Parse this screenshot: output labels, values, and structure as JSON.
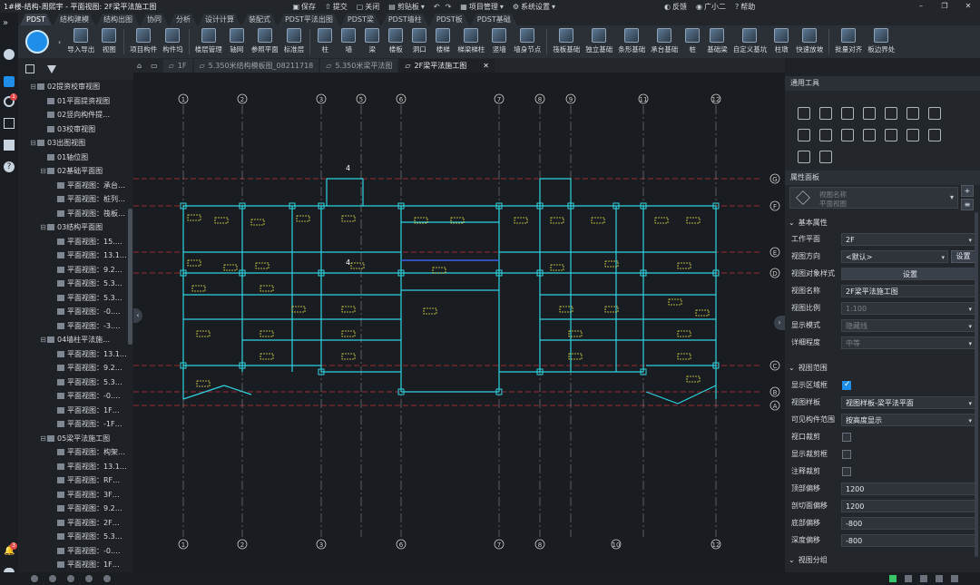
{
  "titlebar": {
    "title": "1#楼-结构-周熙宇 - 平面视图: 2F梁平法施工图",
    "quick": [
      "保存",
      "提交",
      "关闭",
      "剪贴板",
      "项目管理",
      "系统设置"
    ],
    "right": [
      "反馈",
      "广小二",
      "帮助"
    ]
  },
  "ribbon_tabs": [
    "PDST",
    "结构建模",
    "结构出图",
    "协同",
    "分析",
    "设计计算",
    "装配式",
    "PDST平法出图",
    "PDST梁",
    "PDST墙柱",
    "PDST板",
    "PDST基础"
  ],
  "ribbon_groups": [
    [
      "导入导出",
      "视图"
    ],
    [
      "项目构件",
      "构件坞"
    ],
    [
      "楼层管理",
      "轴网",
      "参照平面",
      "标准层"
    ],
    [
      "柱",
      "墙",
      "梁",
      "楼板",
      "洞口",
      "楼梯",
      "梯梁梯柱",
      "竖墙",
      "墙身节点"
    ],
    [
      "筏板基础",
      "独立基础",
      "条形基础",
      "承台基础",
      "桩",
      "基础梁",
      "自定义基坑",
      "柱墩",
      "快速放坡"
    ],
    [
      "批量对齐",
      "板边界处"
    ]
  ],
  "tree": [
    {
      "level": 1,
      "toggle": "⊟",
      "label": "02提资校审视图"
    },
    {
      "level": 2,
      "toggle": "",
      "label": "01平面提资视图"
    },
    {
      "level": 2,
      "toggle": "",
      "label": "02竖向构件提…"
    },
    {
      "level": 2,
      "toggle": "",
      "label": "03校审视图"
    },
    {
      "level": 1,
      "toggle": "⊟",
      "label": "03出图视图"
    },
    {
      "level": 2,
      "toggle": "",
      "label": "01轴位图"
    },
    {
      "level": 2,
      "toggle": "⊟",
      "label": "02基础平面图"
    },
    {
      "level": 3,
      "toggle": "",
      "label": "平面视图：承台…"
    },
    {
      "level": 3,
      "toggle": "",
      "label": "平面视图：桩列…"
    },
    {
      "level": 3,
      "toggle": "",
      "label": "平面视图：筏板…"
    },
    {
      "level": 2,
      "toggle": "⊟",
      "label": "03结构平面图"
    },
    {
      "level": 3,
      "toggle": "",
      "label": "平面视图：15.…"
    },
    {
      "level": 3,
      "toggle": "",
      "label": "平面视图：13.1…"
    },
    {
      "level": 3,
      "toggle": "",
      "label": "平面视图：9.2…"
    },
    {
      "level": 3,
      "toggle": "",
      "label": "平面视图：5.3…"
    },
    {
      "level": 3,
      "toggle": "",
      "label": "平面视图：5.3…"
    },
    {
      "level": 3,
      "toggle": "",
      "label": "平面视图：-0.…"
    },
    {
      "level": 3,
      "toggle": "",
      "label": "平面视图：-3.…"
    },
    {
      "level": 2,
      "toggle": "⊟",
      "label": "04墙柱平法施…"
    },
    {
      "level": 3,
      "toggle": "",
      "label": "平面视图：13.1…"
    },
    {
      "level": 3,
      "toggle": "",
      "label": "平面视图：9.2…"
    },
    {
      "level": 3,
      "toggle": "",
      "label": "平面视图：5.3…"
    },
    {
      "level": 3,
      "toggle": "",
      "label": "平面视图：-0.…"
    },
    {
      "level": 3,
      "toggle": "",
      "label": "平面视图：1F…"
    },
    {
      "level": 3,
      "toggle": "",
      "label": "平面视图：-1F…"
    },
    {
      "level": 2,
      "toggle": "⊟",
      "label": "05梁平法施工图"
    },
    {
      "level": 3,
      "toggle": "",
      "label": "平面视图：构架…"
    },
    {
      "level": 3,
      "toggle": "",
      "label": "平面视图：13.1…"
    },
    {
      "level": 3,
      "toggle": "",
      "label": "平面视图：RF…"
    },
    {
      "level": 3,
      "toggle": "",
      "label": "平面视图：3F…"
    },
    {
      "level": 3,
      "toggle": "",
      "label": "平面视图：9.2…"
    },
    {
      "level": 3,
      "toggle": "",
      "label": "平面视图：2F…"
    },
    {
      "level": 3,
      "toggle": "",
      "label": "平面视图：5.3…"
    },
    {
      "level": 3,
      "toggle": "",
      "label": "平面视图：-0.…"
    },
    {
      "level": 3,
      "toggle": "",
      "label": "平面视图：1F…"
    }
  ],
  "doc_tabs": [
    "1F",
    "5.350米结构模板图_08211718",
    "5.350米梁平法图",
    "2F梁平法施工图"
  ],
  "axes": {
    "vertical": [
      "1",
      "2",
      "3",
      "5",
      "6",
      "7",
      "8",
      "9",
      "11",
      "12"
    ],
    "horizontal": [
      "G",
      "F",
      "E",
      "D",
      "C",
      "B",
      "A"
    ],
    "bottom": [
      "1",
      "2",
      "3",
      "6",
      "7",
      "8",
      "10",
      "12"
    ],
    "marker": "4"
  },
  "props": {
    "tools_title": "通用工具",
    "panel_title": "属性面板",
    "view_type_label": "视图名称",
    "view_type_value": "平面视图",
    "section_basic": "基本属性",
    "section_range": "视图范围",
    "section_group": "视图分组",
    "button_set": "设置",
    "rows": [
      {
        "k": "工作平面",
        "v": "2F",
        "type": "select"
      },
      {
        "k": "视图方向",
        "v": "<默认>",
        "type": "select",
        "btn": "设置"
      },
      {
        "k": "视图对象样式",
        "v": "设置",
        "type": "button"
      },
      {
        "k": "视图名称",
        "v": "2F梁平法施工图",
        "type": "text"
      },
      {
        "k": "视图比例",
        "v": "1:100",
        "type": "select",
        "disabled": true
      },
      {
        "k": "显示模式",
        "v": "隐藏线",
        "type": "select",
        "disabled": true
      },
      {
        "k": "详细程度",
        "v": "中等",
        "type": "select",
        "disabled": true
      }
    ],
    "range_rows": [
      {
        "k": "显示区域框",
        "type": "check",
        "on": true
      },
      {
        "k": "视图样板",
        "v": "视图样板-梁平法平面",
        "type": "select"
      },
      {
        "k": "可见构件范围",
        "v": "按高度显示",
        "type": "select"
      },
      {
        "k": "视口裁剪",
        "type": "check",
        "on": false
      },
      {
        "k": "显示裁剪框",
        "type": "check",
        "on": false
      },
      {
        "k": "注释裁剪",
        "type": "check",
        "on": false
      },
      {
        "k": "顶部偏移",
        "v": "1200",
        "type": "text"
      },
      {
        "k": "剖切面偏移",
        "v": "1200",
        "type": "text"
      },
      {
        "k": "底部偏移",
        "v": "-800",
        "type": "text"
      },
      {
        "k": "深度偏移",
        "v": "-800",
        "type": "text"
      }
    ]
  },
  "colors": {
    "accent": "#1e8ee8",
    "beam": "#2fd3e0",
    "text": "#e6e04a",
    "axis": "#c8c8c8",
    "redline": "#c0303a"
  }
}
